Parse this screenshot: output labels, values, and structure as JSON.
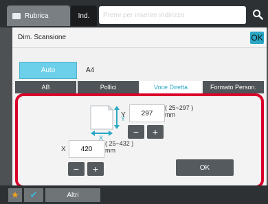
{
  "topbar": {
    "tab_rubrica": "Rubrica",
    "tab_ind": "Ind.",
    "address_placeholder": "Premi per inserire indirizzo"
  },
  "dialog": {
    "title": "Dim. Scansione",
    "ok_top": "OK",
    "auto_label": "Auto",
    "size_value": "A4",
    "tabs": [
      {
        "label": "AB",
        "active": false
      },
      {
        "label": "Pollici",
        "active": false
      },
      {
        "label": "Voce Diretta",
        "active": true
      },
      {
        "label": "Formato Person.",
        "active": false
      }
    ],
    "direct": {
      "y_label": "Y",
      "y_value": "297",
      "y_range": "( 25~297 )",
      "y_unit": "mm",
      "x_label": "X",
      "x_value": "420",
      "x_range": "( 25~432 )",
      "x_unit": "mm",
      "minus": "−",
      "plus": "+",
      "ok_label": "OK"
    }
  },
  "bottombar": {
    "altri_label": "Altri"
  },
  "colors": {
    "accent": "#2aa7c5",
    "highlight_border": "#d9002a",
    "auto_button": "#6dd0ea"
  }
}
